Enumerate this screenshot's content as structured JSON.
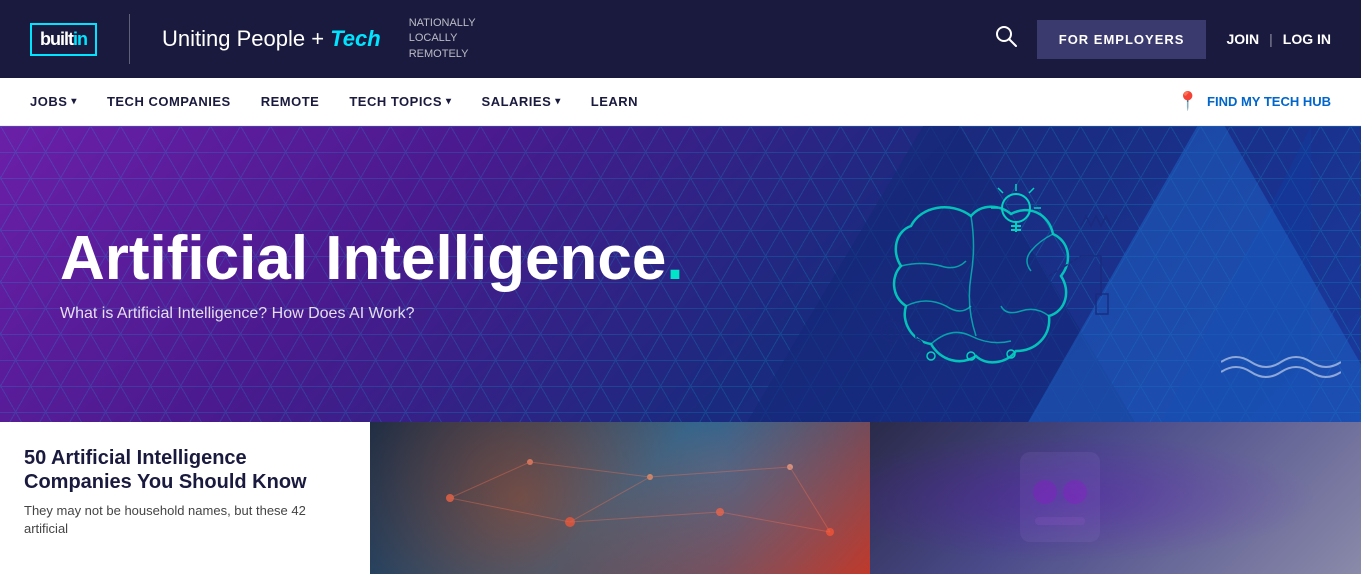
{
  "header": {
    "logo_text": "built",
    "logo_in": "in",
    "tagline_prefix": "Uniting People +",
    "tagline_tech": "Tech",
    "tagline_sub_line1": "NATIONALLY",
    "tagline_sub_line2": "LOCALLY",
    "tagline_sub_line3": "REMOTELY",
    "for_employers_label": "FOR EMPLOYERS",
    "join_label": "JOIN",
    "login_label": "LOG IN"
  },
  "nav": {
    "jobs_label": "JOBS",
    "tech_companies_label": "TECH COMPANIES",
    "remote_label": "REMOTE",
    "tech_topics_label": "TECH TOPICS",
    "salaries_label": "SALARIES",
    "learn_label": "LEARN",
    "find_hub_label": "FIND MY TECH HUB"
  },
  "hero": {
    "title": "Artificial Intelligence",
    "title_dot": ".",
    "subtitle": "What is Artificial Intelligence? How Does AI Work?"
  },
  "cards": [
    {
      "title": "50 Artificial Intelligence Companies You Should Know",
      "description": "They may not be household names, but these 42 artificial"
    }
  ]
}
